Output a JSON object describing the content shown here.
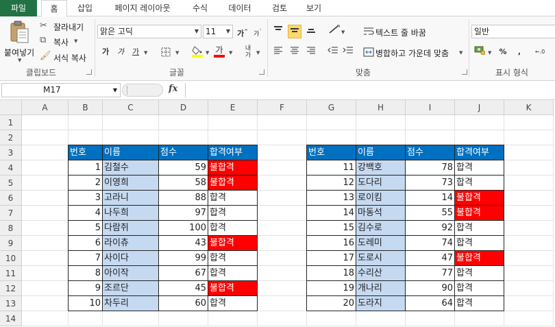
{
  "tabs": [
    "파일",
    "홈",
    "삽입",
    "페이지 레이아웃",
    "수식",
    "데이터",
    "검토",
    "보기"
  ],
  "ribbon": {
    "clipboard": {
      "paste_label": "붙여넣기",
      "cut_label": "잘라내기",
      "copy_label": "복사",
      "format_painter_label": "서식 복사",
      "group_label": "클립보드"
    },
    "font": {
      "font_name": "맑은 고딕",
      "font_size": "11",
      "bold": "가",
      "italic": "가",
      "underline": "가",
      "group_label": "글꼴"
    },
    "alignment": {
      "wrap_text_label": "텍스트 줄 바꿈",
      "merge_center_label": "병합하고 가운데 맞춤",
      "group_label": "맞춤"
    },
    "number": {
      "format_value": "일반",
      "percent": "%",
      "comma": ",",
      "group_label": "표시 형식"
    }
  },
  "formula_bar": {
    "name_box": "M17",
    "fx": "fx",
    "formula": ""
  },
  "sheet": {
    "columns": [
      "A",
      "B",
      "C",
      "D",
      "E",
      "F",
      "G",
      "H",
      "I",
      "J",
      "K"
    ],
    "rows": [
      "1",
      "2",
      "3",
      "4",
      "5",
      "6",
      "7",
      "8",
      "9",
      "10",
      "11",
      "12",
      "13",
      "14"
    ]
  },
  "table_left": {
    "headers": [
      "번호",
      "이름",
      "점수",
      "합격여부"
    ],
    "rows": [
      {
        "num": "1",
        "name": "김철수",
        "score": "59",
        "result": "불합격",
        "fail": true
      },
      {
        "num": "2",
        "name": "이영희",
        "score": "58",
        "result": "불합격",
        "fail": true
      },
      {
        "num": "3",
        "name": "고라니",
        "score": "88",
        "result": "합격",
        "fail": false
      },
      {
        "num": "4",
        "name": "나두희",
        "score": "97",
        "result": "합격",
        "fail": false
      },
      {
        "num": "5",
        "name": "다람쥐",
        "score": "100",
        "result": "합격",
        "fail": false
      },
      {
        "num": "6",
        "name": "라이츄",
        "score": "43",
        "result": "불합격",
        "fail": true
      },
      {
        "num": "7",
        "name": "사이다",
        "score": "99",
        "result": "합격",
        "fail": false
      },
      {
        "num": "8",
        "name": "아이작",
        "score": "67",
        "result": "합격",
        "fail": false
      },
      {
        "num": "9",
        "name": "조르단",
        "score": "45",
        "result": "불합격",
        "fail": true
      },
      {
        "num": "10",
        "name": "차두리",
        "score": "60",
        "result": "합격",
        "fail": false
      }
    ]
  },
  "table_right": {
    "headers": [
      "번호",
      "이름",
      "점수",
      "합격여부"
    ],
    "rows": [
      {
        "num": "11",
        "name": "강백호",
        "score": "78",
        "result": "합격",
        "fail": false
      },
      {
        "num": "12",
        "name": "도다리",
        "score": "73",
        "result": "합격",
        "fail": false
      },
      {
        "num": "13",
        "name": "로이킴",
        "score": "14",
        "result": "불합격",
        "fail": true
      },
      {
        "num": "14",
        "name": "마동석",
        "score": "55",
        "result": "불합격",
        "fail": true
      },
      {
        "num": "15",
        "name": "김수로",
        "score": "92",
        "result": "합격",
        "fail": false
      },
      {
        "num": "16",
        "name": "도레미",
        "score": "74",
        "result": "합격",
        "fail": false
      },
      {
        "num": "17",
        "name": "도로시",
        "score": "47",
        "result": "불합격",
        "fail": true
      },
      {
        "num": "18",
        "name": "수리산",
        "score": "77",
        "result": "합격",
        "fail": false
      },
      {
        "num": "19",
        "name": "개나리",
        "score": "90",
        "result": "합격",
        "fail": false
      },
      {
        "num": "20",
        "name": "도라지",
        "score": "64",
        "result": "합격",
        "fail": false
      }
    ]
  },
  "colors": {
    "header_blue": "#0070c0",
    "name_light_blue": "#c5d9f1",
    "fail_red": "#ff0000",
    "file_tab_green": "#217346"
  }
}
